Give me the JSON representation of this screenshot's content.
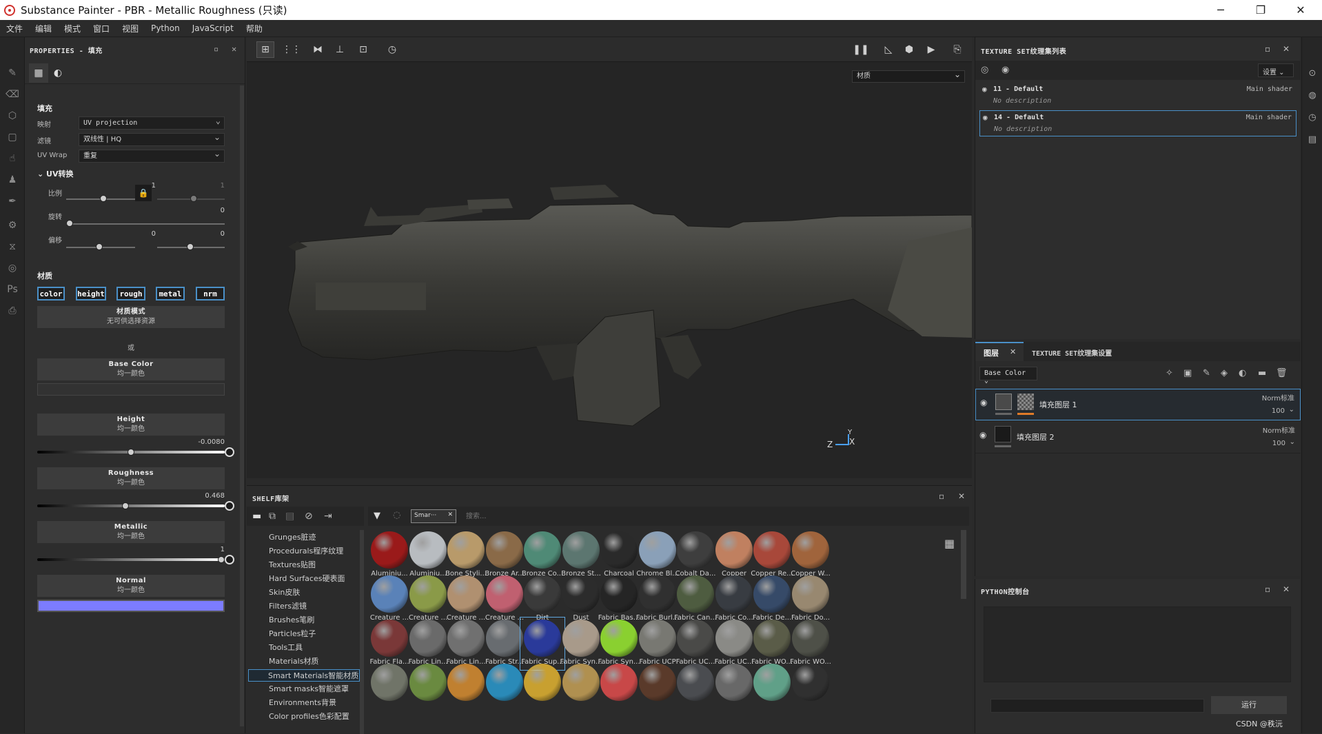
{
  "titlebar": {
    "title": "Substance Painter - PBR - Metallic Roughness (只读)",
    "minimize": "─",
    "maximize": "❐",
    "close": "✕"
  },
  "menu": [
    "文件",
    "编辑",
    "模式",
    "窗口",
    "视图",
    "Python",
    "JavaScript",
    "帮助"
  ],
  "properties": {
    "header": "PROPERTIES - 填充",
    "fill_title": "填充",
    "mapping_label": "映射",
    "mapping_value": "UV projection",
    "filter_label": "滤镜",
    "filter_value": "双线性 | HQ",
    "uvwrap_label": "UV Wrap",
    "uvwrap_value": "重复",
    "uv_transform": "UV转换",
    "scale_label": "比例",
    "scale_value_1": "1",
    "scale_value_2": "1",
    "rotation_label": "旋转",
    "rotation_value": "0",
    "offset_label": "偏移",
    "offset_value_1": "0",
    "offset_value_2": "0",
    "material_title": "材质",
    "channels": [
      "color",
      "height",
      "rough",
      "metal",
      "nrm"
    ],
    "material_mode_title": "材质模式",
    "material_mode_sub": "无可供选择资源",
    "or_label": "或",
    "base_color_title": "Base Color",
    "uniform_color": "均一颜色",
    "height_title": "Height",
    "height_value": "-0.0080",
    "roughness_title": "Roughness",
    "roughness_value": "0.468",
    "metallic_title": "Metallic",
    "metallic_value": "1",
    "normal_title": "Normal",
    "normal_color": "#7c7cff",
    "height_level": 0.5,
    "roughness_level": 0.468,
    "metallic_level": 1.0
  },
  "viewport": {
    "material_dropdown": "材质",
    "axis_z": "Z",
    "axis_y": "Y",
    "axis_x": "X"
  },
  "shelf": {
    "header": "SHELF库架",
    "filter_tag": "Smar···",
    "search_placeholder": "搜索...",
    "categories": [
      "Grunges脏迹",
      "Procedurals程序纹理",
      "Textures贴图",
      "Hard Surfaces硬表面",
      "Skin皮肤",
      "Filters滤镜",
      "Brushes笔刷",
      "Particles粒子",
      "Tools工具",
      "Materials材质",
      "Smart Materials智能材质",
      "Smart masks智能遮罩",
      "Environments背景",
      "Color profiles色彩配置"
    ],
    "active_category": "Smart Materials智能材质",
    "materials": [
      {
        "name": "Aluminiu...",
        "color": "#9a1a1a"
      },
      {
        "name": "Aluminiu...",
        "color": "#b8bcc0"
      },
      {
        "name": "Bone Styli...",
        "color": "#b89a6a"
      },
      {
        "name": "Bronze Ar...",
        "color": "#8a6a48"
      },
      {
        "name": "Bronze Co...",
        "color": "#4f8a76"
      },
      {
        "name": "Bronze St...",
        "color": "#5c7670"
      },
      {
        "name": "Charcoal",
        "color": "#2a2a2a"
      },
      {
        "name": "Chrome Bl...",
        "color": "#8aa0b8"
      },
      {
        "name": "Cobalt Da...",
        "color": "#3e3e3e"
      },
      {
        "name": "Copper",
        "color": "#c08060"
      },
      {
        "name": "Copper Re...",
        "color": "#a8483a"
      },
      {
        "name": "Copper W...",
        "color": "#a0643c"
      },
      {
        "name": "Creature ...",
        "color": "#5a82b8"
      },
      {
        "name": "Creature ...",
        "color": "#8a9a48"
      },
      {
        "name": "Creature ...",
        "color": "#b09070"
      },
      {
        "name": "Creature ...",
        "color": "#c06070"
      },
      {
        "name": "Dirt",
        "color": "#3a3a3a"
      },
      {
        "name": "Dust",
        "color": "#2c2c2c"
      },
      {
        "name": "Fabric Bas...",
        "color": "#252525"
      },
      {
        "name": "Fabric Burl...",
        "color": "#303030"
      },
      {
        "name": "Fabric Can...",
        "color": "#4e5c40"
      },
      {
        "name": "Fabric Co...",
        "color": "#383c42"
      },
      {
        "name": "Fabric De...",
        "color": "#364a68"
      },
      {
        "name": "Fabric Do...",
        "color": "#988870"
      },
      {
        "name": "Fabric Fla...",
        "color": "#7a3838"
      },
      {
        "name": "Fabric Lin...",
        "color": "#6a6a6a"
      },
      {
        "name": "Fabric Lin...",
        "color": "#707070"
      },
      {
        "name": "Fabric Str...",
        "color": "#686c70"
      },
      {
        "name": "Fabric Sup...",
        "color": "#2a3a9a"
      },
      {
        "name": "Fabric Syn...",
        "color": "#a89a8a"
      },
      {
        "name": "Fabric Syn...",
        "color": "#8ad030"
      },
      {
        "name": "Fabric UCP",
        "color": "#787872"
      },
      {
        "name": "Fabric UC...",
        "color": "#4a4a48"
      },
      {
        "name": "Fabric UC...",
        "color": "#8a8a86"
      },
      {
        "name": "Fabric WO...",
        "color": "#5a5c48"
      },
      {
        "name": "Fabric WO...",
        "color": "#4e5048"
      },
      {
        "name": "",
        "color": "#707468"
      },
      {
        "name": "",
        "color": "#6a8a40"
      },
      {
        "name": "",
        "color": "#c08030"
      },
      {
        "name": "",
        "color": "#2a8ab8"
      },
      {
        "name": "",
        "color": "#c8a030"
      },
      {
        "name": "",
        "color": "#b09050"
      },
      {
        "name": "",
        "color": "#c84848"
      },
      {
        "name": "",
        "color": "#5a3a2a"
      },
      {
        "name": "",
        "color": "#4a4c50"
      },
      {
        "name": "",
        "color": "#686868"
      },
      {
        "name": "",
        "color": "#60a088"
      },
      {
        "name": "",
        "color": "#303030"
      }
    ],
    "selected_material_index": 28
  },
  "texture_sets": {
    "header": "TEXTURE SET纹理集列表",
    "settings_label": "设置",
    "items": [
      {
        "name": "11 - Default",
        "shader": "Main shader",
        "description": "No description"
      },
      {
        "name": "14 - Default",
        "shader": "Main shader",
        "description": "No description"
      }
    ]
  },
  "layers": {
    "tab_layers": "图层",
    "tab_settings": "TEXTURE SET纹理集设置",
    "channel_dropdown": "Base Color",
    "items": [
      {
        "name": "填充图层 1",
        "blend": "Norm标准",
        "opacity": "100"
      },
      {
        "name": "填充图层 2",
        "blend": "Norm标准",
        "opacity": "100"
      }
    ]
  },
  "python_console": {
    "header": "PYTHON控制台",
    "run_label": "运行"
  },
  "watermark": "CSDN @秩沅"
}
